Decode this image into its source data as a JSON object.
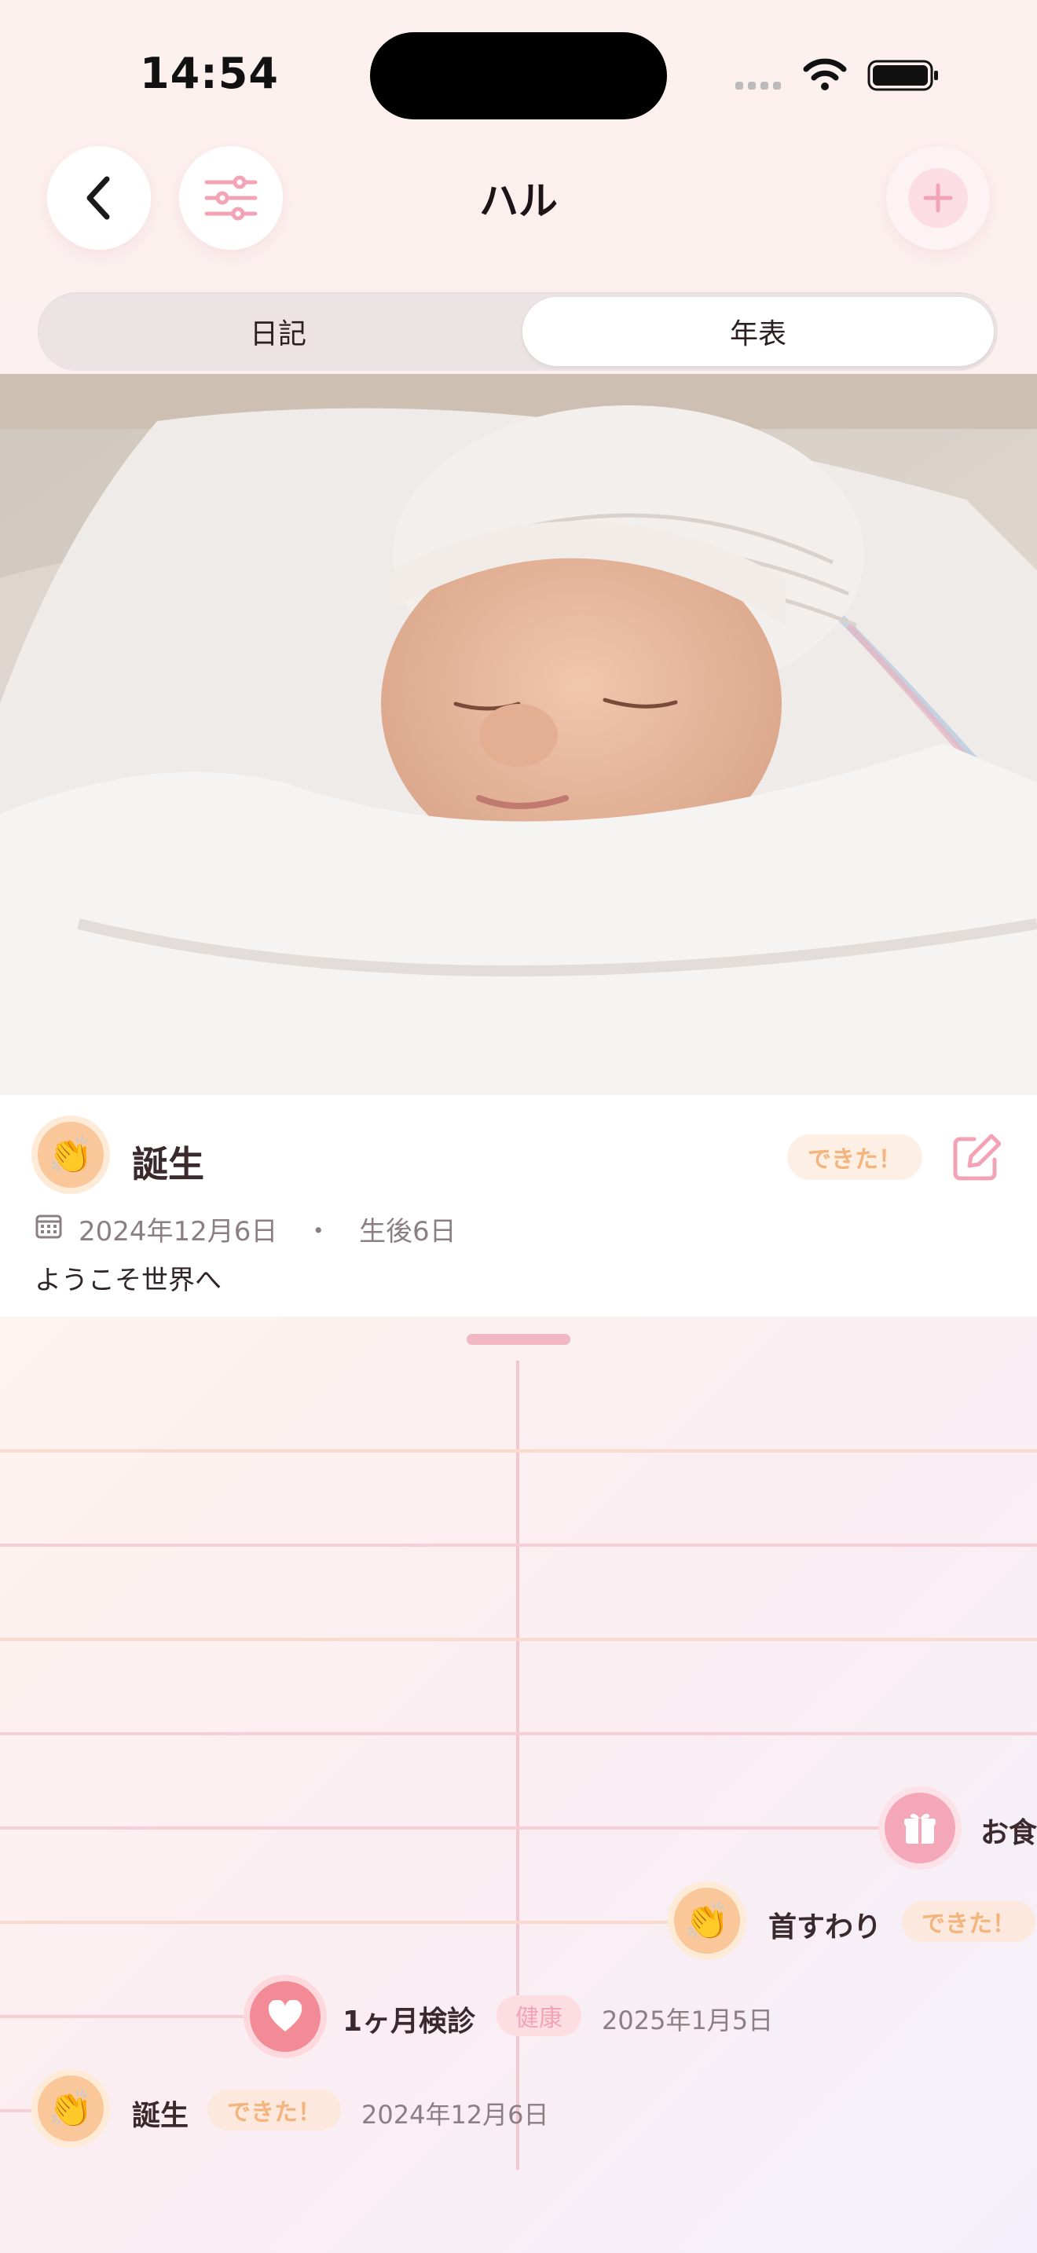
{
  "status_bar": {
    "time": "14:54"
  },
  "header": {
    "title": "ハル"
  },
  "segments": {
    "left": "日記",
    "right": "年表"
  },
  "detail": {
    "title": "誕生",
    "badge": "できた！",
    "date": "2024年12月6日",
    "separator": "・",
    "age": "生後6日",
    "description": "ようこそ世界へ"
  },
  "timeline": {
    "events": [
      {
        "label": "お食",
        "icon": "gift-icon"
      },
      {
        "label": "首すわり",
        "tag": "できた！",
        "icon": "clap-icon"
      },
      {
        "label": "1ヶ月検診",
        "tag": "健康",
        "date": "2025年1月5日",
        "icon": "heart-icon"
      },
      {
        "label": "誕生",
        "tag": "できた！",
        "date": "2024年12月6日",
        "icon": "clap-icon"
      }
    ]
  },
  "colors": {
    "accent_pink": "#f2a4b6",
    "accent_orange": "#f9c79a",
    "heart_red": "#f28b96"
  }
}
